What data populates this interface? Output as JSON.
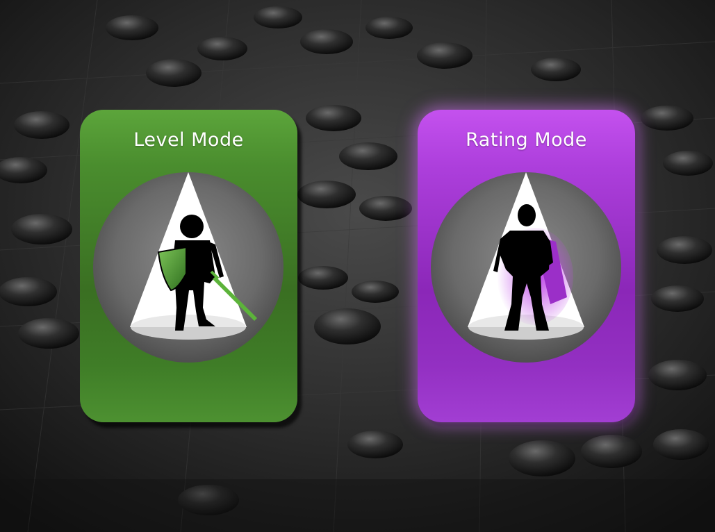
{
  "modes": [
    {
      "title": "Level Mode",
      "icon": "knight-with-shield-and-sword-icon",
      "accent": "#4f9a33"
    },
    {
      "title": "Rating Mode",
      "icon": "superhero-with-cape-icon",
      "accent": "#b043e0",
      "highlighted": true
    }
  ]
}
